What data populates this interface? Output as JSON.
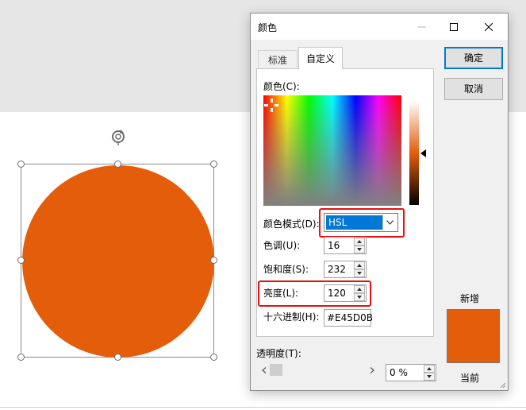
{
  "document": {
    "shape_fill": "#e45d0b"
  },
  "dialog": {
    "title": "颜色",
    "tabs": [
      {
        "label": "标准"
      },
      {
        "label": "自定义"
      }
    ],
    "colors_label": "颜色(C):",
    "color_mode": {
      "label": "颜色模式(D):",
      "value": "HSL"
    },
    "hue": {
      "label": "色调(U):",
      "value": "16"
    },
    "saturation": {
      "label": "饱和度(S):",
      "value": "232"
    },
    "luminance": {
      "label": "亮度(L):",
      "value": "120"
    },
    "hex": {
      "label": "十六进制(H):",
      "value": "#E45D0B"
    },
    "transparency": {
      "label": "透明度(T):",
      "value": "0 %"
    },
    "ok_label": "确定",
    "cancel_label": "取消",
    "new_label": "新增",
    "current_label": "当前",
    "new_color": "#e45d0b",
    "current_color": "#e45d0b"
  }
}
